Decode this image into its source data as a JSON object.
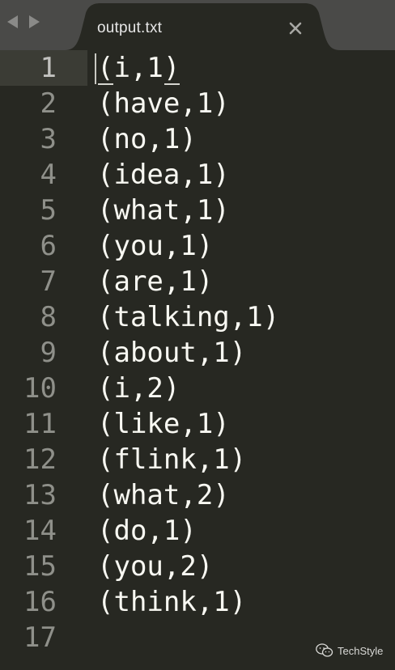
{
  "tab": {
    "title": "output.txt"
  },
  "icons": {
    "back": "chevron-left-icon",
    "forward": "chevron-right-icon",
    "close": "close-icon",
    "watermark": "wechat-icon"
  },
  "colors": {
    "editor_background": "#272822",
    "tabbar_background": "#4a4a48",
    "text": "#f8f8f2",
    "line_number": "#8f908a"
  },
  "editor": {
    "active_line": 1,
    "lines": [
      {
        "number": "1",
        "text": "(i,1)"
      },
      {
        "number": "2",
        "text": "(have,1)"
      },
      {
        "number": "3",
        "text": "(no,1)"
      },
      {
        "number": "4",
        "text": "(idea,1)"
      },
      {
        "number": "5",
        "text": "(what,1)"
      },
      {
        "number": "6",
        "text": "(you,1)"
      },
      {
        "number": "7",
        "text": "(are,1)"
      },
      {
        "number": "8",
        "text": "(talking,1)"
      },
      {
        "number": "9",
        "text": "(about,1)"
      },
      {
        "number": "10",
        "text": "(i,2)"
      },
      {
        "number": "11",
        "text": "(like,1)"
      },
      {
        "number": "12",
        "text": "(flink,1)"
      },
      {
        "number": "13",
        "text": "(what,2)"
      },
      {
        "number": "14",
        "text": "(do,1)"
      },
      {
        "number": "15",
        "text": "(you,2)"
      },
      {
        "number": "16",
        "text": "(think,1)"
      },
      {
        "number": "17",
        "text": ""
      }
    ]
  },
  "watermark": {
    "text": "TechStyle"
  }
}
